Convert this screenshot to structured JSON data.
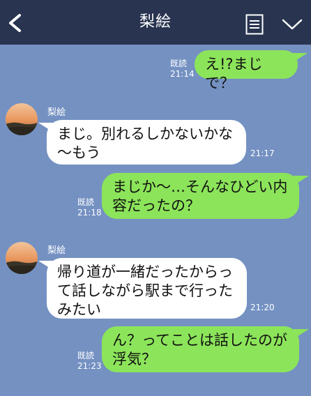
{
  "header": {
    "title": "梨絵",
    "back_icon": "chevron-left-icon",
    "menu_icon": "menu-icon",
    "down_icon": "chevron-down-icon",
    "background": "#283450"
  },
  "colors": {
    "chat_background": "#7491c2",
    "outgoing_bubble": "#8ce45a",
    "incoming_bubble": "#ffffff"
  },
  "messages": [
    {
      "direction": "out",
      "text": "え!?まじで？",
      "read": "既読",
      "time": "21:14"
    },
    {
      "direction": "in",
      "sender": "梨絵",
      "text": "まじ。別れるしかないかな\n〜もう",
      "time": "21:17"
    },
    {
      "direction": "out",
      "text": "まじか〜…そんなひどい内\n容だったの？",
      "read": "既読",
      "time": "21:18"
    },
    {
      "direction": "in",
      "sender": "梨絵",
      "text": "帰り道が一緒だったからっ\nて話しながら駅まで行った\nみたい",
      "time": "21:20"
    },
    {
      "direction": "out",
      "text": "ん？ってことは話したのが\n浮気？",
      "read": "既読",
      "time": "21:23"
    }
  ]
}
